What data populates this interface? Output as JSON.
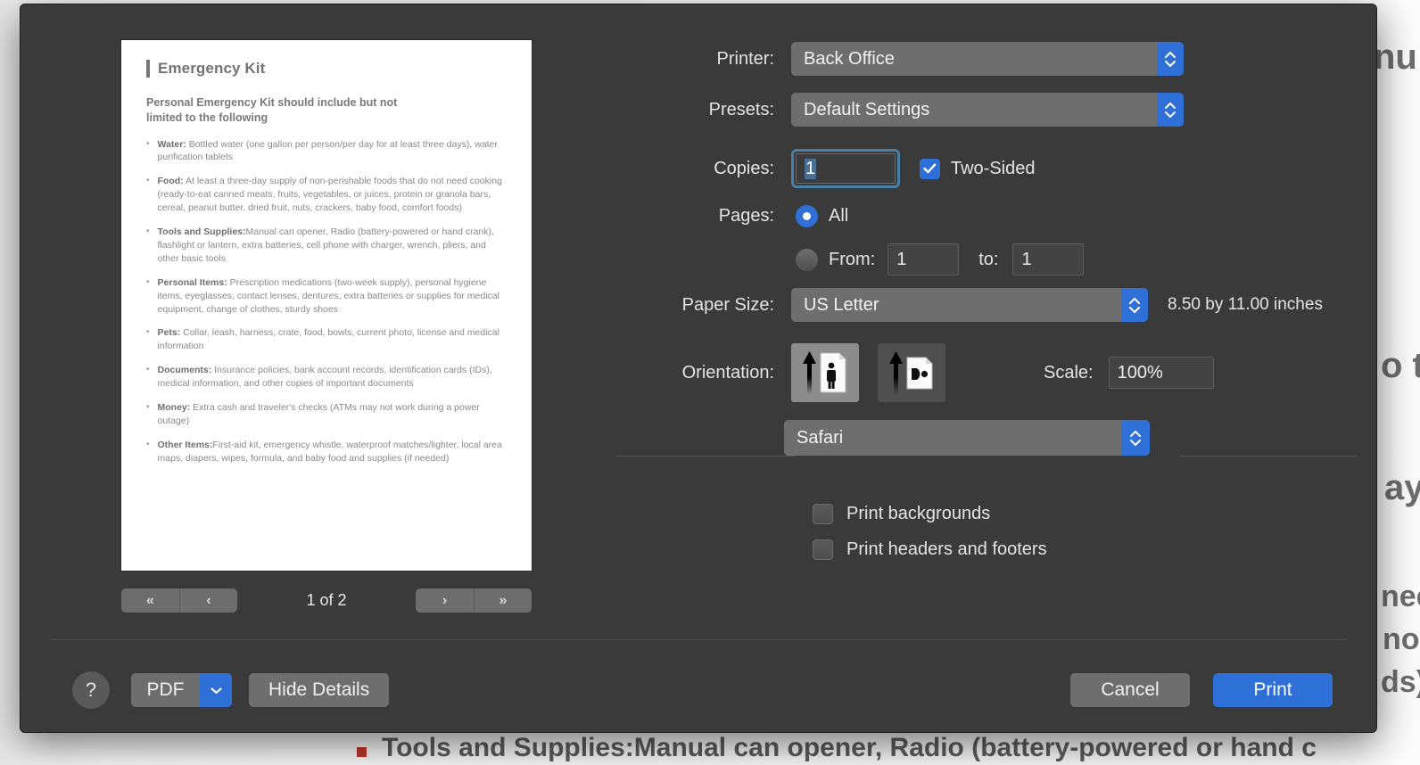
{
  "background": {
    "fragments": [
      "nu",
      "o t",
      "ay",
      "nee",
      "no",
      "ds)"
    ],
    "bottom_text": "Tools and Supplies:Manual can opener, Radio (battery-powered or hand c"
  },
  "dialog": {
    "preview": {
      "title": "Emergency Kit",
      "subtitle": "Personal Emergency Kit should include but not limited to the following",
      "bullets": [
        {
          "term": "Water:",
          "text": " Bottled water (one gallon per person/per day for at least three days), water purification tablets"
        },
        {
          "term": "Food:",
          "text": " At least a three-day supply of non-perishable foods that do not need cooking (ready-to-eat canned meats, fruits, vegetables, or juices, protein or granola bars, cereal, peanut butter, dried fruit, nuts, crackers, baby food, comfort foods)"
        },
        {
          "term": "Tools and Supplies:",
          "text": "Manual can opener, Radio (battery-powered or hand crank), flashlight or lantern, extra batteries, cell phone with charger, wrench, pliers, and other basic tools"
        },
        {
          "term": "Personal Items:",
          "text": " Prescription medications (two-week supply), personal hygiene items, eyeglasses, contact lenses, dentures, extra batteries or supplies for medical equipment, change of clothes, sturdy shoes"
        },
        {
          "term": "Pets:",
          "text": " Collar, leash, harness, crate, food, bowls, current photo, license and medical information"
        },
        {
          "term": "Documents:",
          "text": " Insurance policies, bank account records, identification cards (IDs), medical information, and other copies of important documents"
        },
        {
          "term": "Money:",
          "text": " Extra cash and traveler's checks (ATMs may not work during a power outage)"
        },
        {
          "term": "Other Items:",
          "text": "First-aid kit, emergency whistle, waterproof matches/lighter, local area maps, diapers, wipes, formula, and baby food and supplies (if needed)"
        }
      ]
    },
    "page_nav": {
      "first_label": "«",
      "prev_label": "‹",
      "next_label": "›",
      "last_label": "»",
      "indicator": "1 of 2"
    },
    "fields": {
      "printer_label": "Printer:",
      "printer_value": "Back Office",
      "presets_label": "Presets:",
      "presets_value": "Default Settings",
      "copies_label": "Copies:",
      "copies_value": "1",
      "two_sided_label": "Two-Sided",
      "two_sided_checked": true,
      "pages_label": "Pages:",
      "pages_all_label": "All",
      "pages_all_selected": true,
      "pages_from_label": "From:",
      "pages_from_value": "1",
      "pages_to_label": "to:",
      "pages_to_value": "1",
      "paper_size_label": "Paper Size:",
      "paper_size_value": "US Letter",
      "paper_dimensions": "8.50 by 11.00 inches",
      "orientation_label": "Orientation:",
      "orientation_selected": "portrait",
      "scale_label": "Scale:",
      "scale_value": "100%",
      "app_popup_value": "Safari",
      "print_backgrounds_label": "Print backgrounds",
      "print_backgrounds_checked": false,
      "print_headers_label": "Print headers and footers",
      "print_headers_checked": false
    },
    "buttons": {
      "help_label": "?",
      "pdf_label": "PDF",
      "hide_details_label": "Hide Details",
      "cancel_label": "Cancel",
      "print_label": "Print"
    },
    "colors": {
      "accent": "#2f6fd8",
      "dialog_bg": "#3a3a3a",
      "control_bg": "#6e6e6e"
    }
  }
}
